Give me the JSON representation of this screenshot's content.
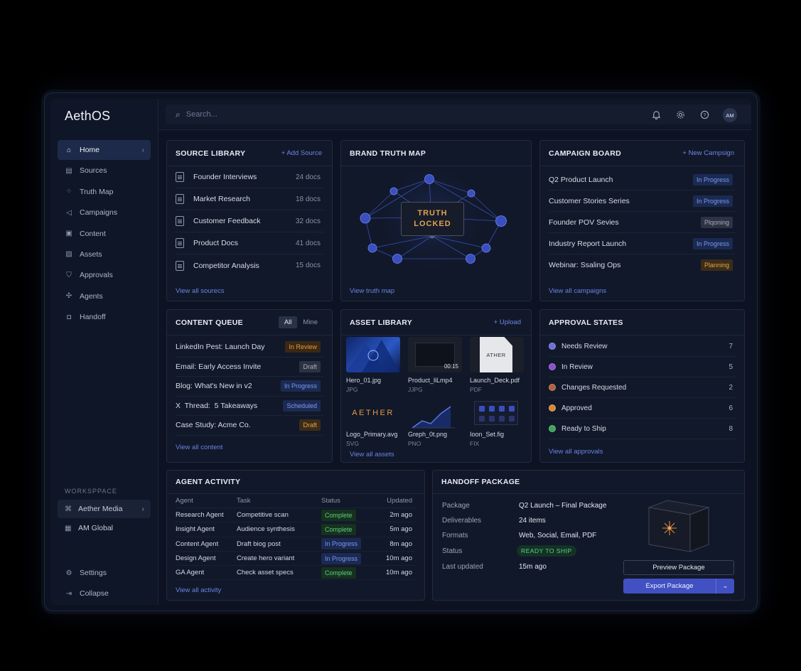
{
  "app": {
    "name": "AethOS"
  },
  "nav": [
    {
      "label": "Home",
      "icon": "home-icon",
      "glyph": "⌂",
      "active": true
    },
    {
      "label": "Sources",
      "icon": "sources-icon",
      "glyph": "▤"
    },
    {
      "label": "Truth Map",
      "icon": "truth-map-icon",
      "glyph": "⁘"
    },
    {
      "label": "Campaigns",
      "icon": "megaphone-icon",
      "glyph": "◁"
    },
    {
      "label": "Content",
      "icon": "content-icon",
      "glyph": "▣"
    },
    {
      "label": "Assets",
      "icon": "image-icon",
      "glyph": "▨"
    },
    {
      "label": "Approvals",
      "icon": "shield-check-icon",
      "glyph": "⛉"
    },
    {
      "label": "Agents",
      "icon": "agents-icon",
      "glyph": "✣"
    },
    {
      "label": "Handoff",
      "icon": "handoff-icon",
      "glyph": "◘"
    }
  ],
  "workspace": {
    "label": "WORKSPPACE",
    "items": [
      {
        "label": "Aether Media",
        "glyph": "⌘"
      },
      {
        "label": "AM Global",
        "glyph": "▦"
      }
    ]
  },
  "bottom_nav": [
    {
      "label": "Settings",
      "glyph": "⚙"
    },
    {
      "label": "Collapse",
      "glyph": "⇥"
    }
  ],
  "topbar": {
    "search_placeholder": "Search...",
    "avatar_initials": "AM"
  },
  "source_library": {
    "title": "SOURCE LIBRARY",
    "action": "+ Add Source",
    "items": [
      {
        "label": "Founder Interviews",
        "count": "24 docs"
      },
      {
        "label": "Market Research",
        "count": "18 docs"
      },
      {
        "label": "Customer Feedback",
        "count": "32 docs"
      },
      {
        "label": "Product Docs",
        "count": "41 docs"
      },
      {
        "label": "Competitor Analysis",
        "count": "15 docs"
      }
    ],
    "footer": "View all sourecs"
  },
  "brand_truth_map": {
    "title": "BRAND TRUTH MAP",
    "center_line1": "TRUTH",
    "center_line2": "LOCKED",
    "footer": "View truth map"
  },
  "campaign_board": {
    "title": "CAMPAIGN BOARD",
    "action": "+ New Campsign",
    "items": [
      {
        "label": "Q2 Product Launch",
        "status": "In Progress"
      },
      {
        "label": "Customer Stories Series",
        "status": "In Progress"
      },
      {
        "label": "Founder POV Sevies",
        "status": "Plqoning"
      },
      {
        "label": "Industry Report Launch",
        "status": "In Progress"
      },
      {
        "label": "Webinar: Ssaling Ops",
        "status": "Planning"
      }
    ],
    "footer": "View all campaigns"
  },
  "content_queue": {
    "title": "CONTENT QUEUE",
    "toggle": [
      "All",
      "Mine"
    ],
    "items": [
      {
        "label": "LinkedIn Pest: Launch Day",
        "status": "In Review"
      },
      {
        "label": "Email: Early Access Invite",
        "status": "Draft"
      },
      {
        "label": "Blog: What's New in v2",
        "status": "In Progress"
      },
      {
        "label": "X  Thread:  5 Takeaways",
        "status": "Scheduled"
      },
      {
        "label": "Case Study: Acme Co.",
        "status": "Draft"
      }
    ],
    "footer": "View all content"
  },
  "asset_library": {
    "title": "ASSET LIBRARY",
    "action": "+ Upload",
    "items": [
      {
        "name": "Hero_01.jpg",
        "type": "JPG"
      },
      {
        "name": "Product_liLmp4",
        "type": "JJPG",
        "duration": "00:15"
      },
      {
        "name": "Launch_Deck.pdf",
        "type": "PDF",
        "thumb_text": "ATHER"
      },
      {
        "name": "Logo_Primary.avg",
        "type": "SVG",
        "thumb_text": "AETHER"
      },
      {
        "name": "Greph_0t.png",
        "type": "PNO"
      },
      {
        "name": "Ioon_Set.fig",
        "type": "FIX"
      }
    ],
    "footer": "View all assets"
  },
  "approval_states": {
    "title": "APPROVAL STATES",
    "items": [
      {
        "label": "Needs Review",
        "count": "7",
        "color": "#6b6fd6"
      },
      {
        "label": "In Review",
        "count": "5",
        "color": "#8b4fd1"
      },
      {
        "label": "Changes Requested",
        "count": "2",
        "color": "#b0623a"
      },
      {
        "label": "Approved",
        "count": "6",
        "color": "#d98a2f"
      },
      {
        "label": "Ready to Ship",
        "count": "8",
        "color": "#3ea55a"
      }
    ],
    "footer": "View all approvals"
  },
  "agent_activity": {
    "title": "AGENT ACTIVITY",
    "columns": [
      "Agent",
      "Task",
      "Status",
      "Updated"
    ],
    "rows": [
      {
        "agent": "Research Agent",
        "task": "Competitive scan",
        "status": "Complete",
        "updated": "2m ago"
      },
      {
        "agent": "Insight Agent",
        "task": "Audience synthesis",
        "status": "Complete",
        "updated": "5m ago"
      },
      {
        "agent": "Content Agent",
        "task": "Draft biog post",
        "status": "In Progress",
        "updated": "8m ago"
      },
      {
        "agent": "Design Agent",
        "task": "Create hero variant",
        "status": "In Progress",
        "updated": "10m ago"
      },
      {
        "agent": "GA Agent",
        "task": "Check asset specs",
        "status": "Complete",
        "updated": "10m ago"
      }
    ],
    "footer": "View all activity"
  },
  "handoff_package": {
    "title": "HANDOFF PACKAGE",
    "fields": [
      {
        "key": "Package",
        "value": "Q2 Launch – Final Package"
      },
      {
        "key": "Deliverables",
        "value": "24 items"
      },
      {
        "key": "Formats",
        "value": "Web, Social, Email, PDF"
      },
      {
        "key": "Status",
        "value": "READY TO SHIP"
      },
      {
        "key": "Last updated",
        "value": "15m ago"
      }
    ],
    "preview_button": "Preview Package",
    "export_button": "Export Package"
  },
  "colors": {
    "accent": "#4150c3",
    "link": "#6a83e4",
    "warning": "#e29a45",
    "success": "#5fcc7d"
  }
}
